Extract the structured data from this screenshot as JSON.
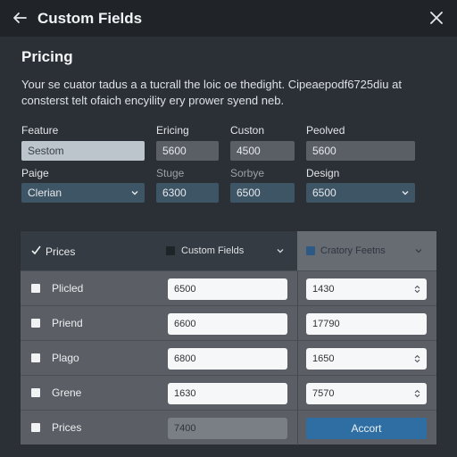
{
  "window": {
    "title": "Custom Fields"
  },
  "section": {
    "title": "Pricing",
    "description": "Your se cuator tadus a a tucrall the loic oe thedight. Cipeaepodf6725diu at consterst telt ofaich encyility ery prower syend neb."
  },
  "form": {
    "labels_row1": [
      "Feature",
      "Ericing",
      "Custon",
      "Peolved"
    ],
    "values_row1": [
      "Sestom",
      "5600",
      "4500",
      "5600"
    ],
    "labels_row2": [
      "Paige",
      "Stuge",
      "Sorbye",
      "Design"
    ],
    "values_row2": [
      "Clerian",
      "6300",
      "6500",
      "6500"
    ]
  },
  "table": {
    "header": {
      "col1": "Prices",
      "col2": "Custom Fields",
      "col3": "Cratory Feetns"
    },
    "rows": [
      {
        "name": "Plicled",
        "value": "6500",
        "number": "1430"
      },
      {
        "name": "Priend",
        "value": "6600",
        "number": "17790"
      },
      {
        "name": "Plago",
        "value": "6800",
        "number": "1650"
      },
      {
        "name": "Grene",
        "value": "1630",
        "number": "7570"
      },
      {
        "name": "Prices",
        "value": "7400",
        "action": "Accort"
      }
    ]
  },
  "icons": {
    "back": "arrow-left-icon",
    "close": "close-icon",
    "dropdown": "chevron-down-icon",
    "check": "checkmark-icon",
    "spinner": "stepper-icon"
  },
  "colors": {
    "accent": "#2e6ea3",
    "titlebar": "#202428",
    "background": "#2b3036"
  }
}
